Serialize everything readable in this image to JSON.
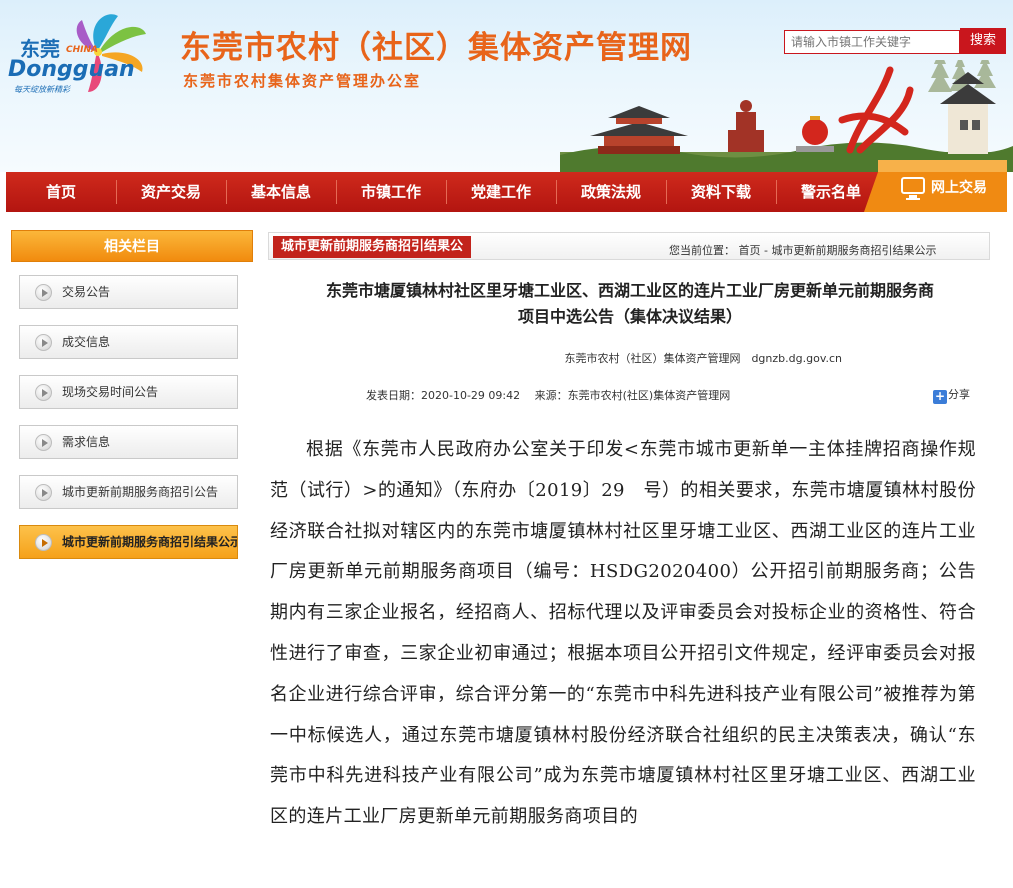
{
  "header": {
    "logo_cn": "东莞",
    "logo_en": "Dongguan",
    "logo_china": "CHINA",
    "logo_slogan": "每天绽放新精彩",
    "site_title": "东莞市农村（社区）集体资产管理网",
    "site_subtitle": "东莞市农村集体资产管理办公室",
    "search": {
      "placeholder": "请输入市镇工作关键字",
      "button": "搜索"
    }
  },
  "nav": {
    "items": [
      "首页",
      "资产交易",
      "基本信息",
      "市镇工作",
      "党建工作",
      "政策法规",
      "资料下载",
      "警示名单"
    ],
    "online": "网上交易"
  },
  "sidebar": {
    "title": "相关栏目",
    "items": [
      {
        "label": "交易公告"
      },
      {
        "label": "成交信息"
      },
      {
        "label": "现场交易时间公告"
      },
      {
        "label": "需求信息"
      },
      {
        "label": "城市更新前期服务商招引公告"
      },
      {
        "label": "城市更新前期服务商招引结果公示"
      }
    ]
  },
  "breadcrumb": {
    "tab": "城市更新前期服务商招引结果公",
    "location": "您当前位置：  首页 - 城市更新前期服务商招引结果公示"
  },
  "article": {
    "title_line1": "东莞市塘厦镇林村社区里牙塘工业区、西湖工业区的连片工业厂房更新单元前期服务商",
    "title_line2": "项目中选公告（集体决议结果）",
    "source_line": "东莞市农村（社区）集体资产管理网　dgnzb.dg.gov.cn",
    "meta": "发表日期：2020-10-29 09:42　 来源：东莞市农村(社区)集体资产管理网",
    "share": "分享",
    "body": "根据《东莞市人民政府办公室关于印发<东莞市城市更新单一主体挂牌招商操作规范（试行）>的通知》（东府办〔2019〕29　号）的相关要求，东莞市塘厦镇林村股份经济联合社拟对辖区内的东莞市塘厦镇林村社区里牙塘工业区、西湖工业区的连片工业厂房更新单元前期服务商项目（编号：HSDG2020400）公开招引前期服务商；公告期内有三家企业报名，经招商人、招标代理以及评审委员会对投标企业的资格性、符合性进行了审查，三家企业初审通过；根据本项目公开招引文件规定，经评审委员会对报名企业进行综合评审，综合评分第一的“东莞市中科先进科技产业有限公司”被推荐为第一中标候选人，通过东莞市塘厦镇林村股份经济联合社组织的民主决策表决，确认“东莞市中科先进科技产业有限公司”成为东莞市塘厦镇林村社区里牙塘工业区、西湖工业区的连片工业厂房更新单元前期服务商项目的"
  },
  "colors": {
    "brand_red": "#c2231b",
    "title_orange": "#e8641a",
    "sidebar_orange": "#f18b0e"
  },
  "icons": {
    "play": "play-circle-icon",
    "share": "plus-share-icon",
    "online": "monitor-icon"
  }
}
